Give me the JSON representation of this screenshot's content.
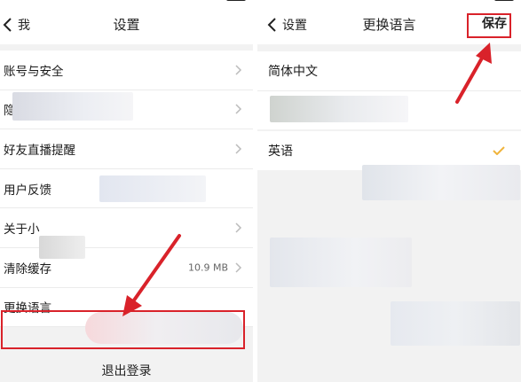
{
  "left_screen": {
    "back_label": "我",
    "title": "设置",
    "items": [
      {
        "label": "账号与安全"
      },
      {
        "label": "隐"
      },
      {
        "label": "好友直播提醒"
      },
      {
        "label": "用户反馈"
      },
      {
        "label": "关于小"
      },
      {
        "label": "清除缓存",
        "value": "10.9 MB"
      },
      {
        "label": "更换语言"
      }
    ],
    "logout_label": "退出登录"
  },
  "right_screen": {
    "back_label": "设置",
    "title": "更换语言",
    "save_label": "保存",
    "languages": [
      {
        "label": "简体中文",
        "selected": false
      },
      {
        "label": "英语",
        "selected": true
      }
    ]
  },
  "colors": {
    "highlight": "#d9222a",
    "arrow": "#d9222a",
    "check": "#f0b43c",
    "background": "#f2f2f2"
  },
  "icons": [
    "back-chevron-icon",
    "chevron-right-icon",
    "checkmark-icon",
    "battery-icon"
  ]
}
